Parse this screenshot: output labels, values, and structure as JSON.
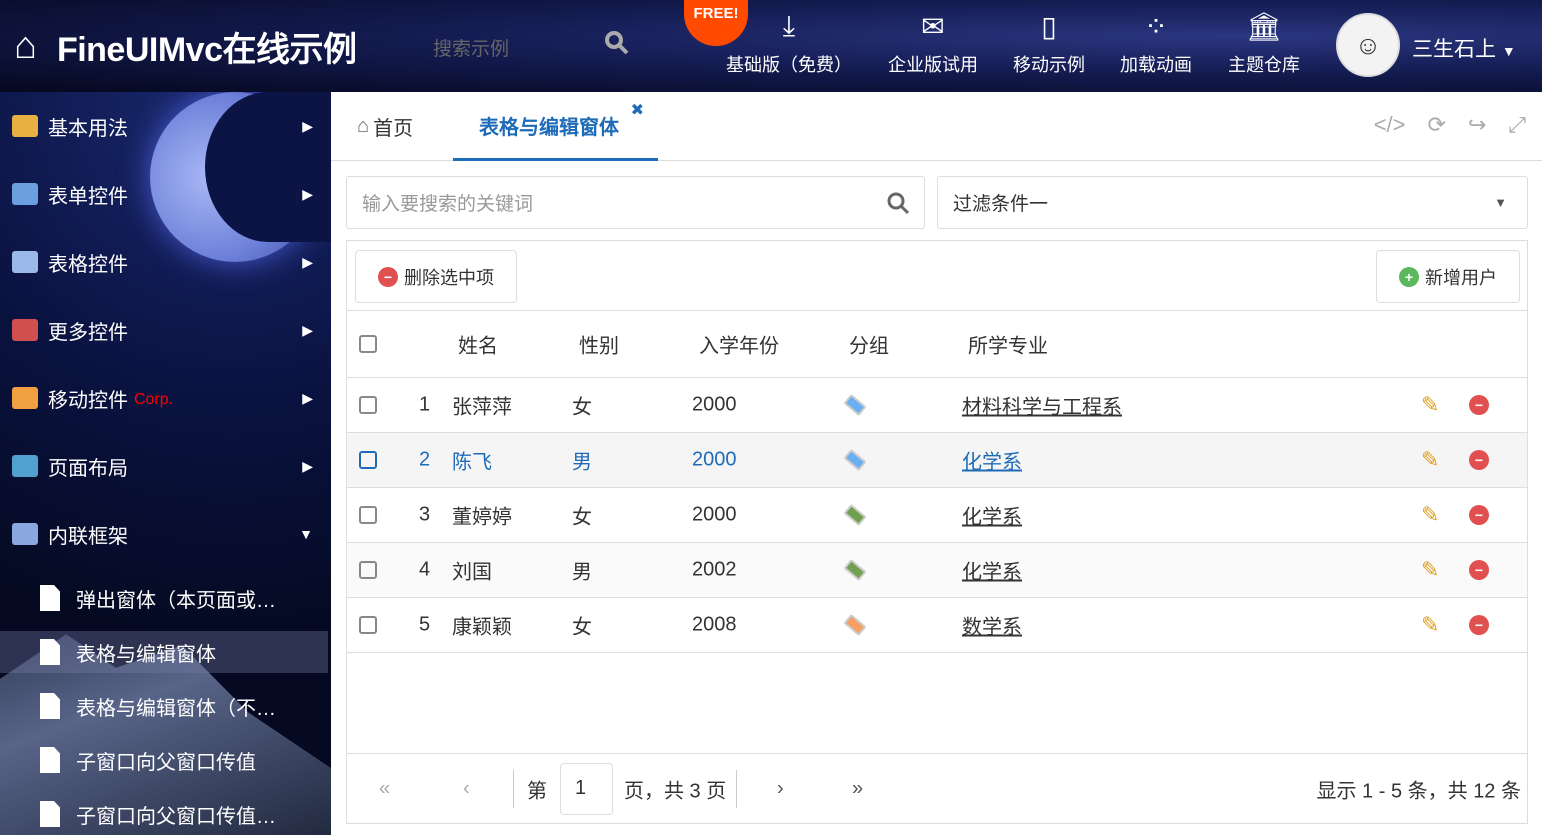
{
  "header": {
    "title": "FineUIMvc在线示例",
    "search_placeholder": "搜索示例",
    "free_badge": "FREE!",
    "nav": [
      {
        "label": "基础版（免费）",
        "icon": "download-icon"
      },
      {
        "label": "企业版试用",
        "icon": "envelope-icon"
      },
      {
        "label": "移动示例",
        "icon": "mobile-icon"
      },
      {
        "label": "加载动画",
        "icon": "spinner-icon"
      },
      {
        "label": "主题仓库",
        "icon": "bank-icon"
      }
    ],
    "user": "三生石上"
  },
  "sidebar": {
    "items": [
      {
        "label": "基本用法",
        "color": "#e8b040"
      },
      {
        "label": "表单控件",
        "color": "#6aa0e0"
      },
      {
        "label": "表格控件",
        "color": "#9ab8e8"
      },
      {
        "label": "更多控件",
        "color": "#d05050"
      },
      {
        "label": "移动控件",
        "badge": "Corp.",
        "color": "#f0a040"
      },
      {
        "label": "页面布局",
        "color": "#50a0d0"
      },
      {
        "label": "内联框架",
        "color": "#8aa8e0"
      }
    ],
    "subitems": [
      {
        "label": "弹出窗体（本页面或…"
      },
      {
        "label": "表格与编辑窗体"
      },
      {
        "label": "表格与编辑窗体（不…"
      },
      {
        "label": "子窗口向父窗口传值"
      },
      {
        "label": "子窗口向父窗口传值…"
      }
    ]
  },
  "tabs": {
    "home": "首页",
    "active": "表格与编辑窗体"
  },
  "search": {
    "placeholder": "输入要搜索的关键词",
    "filter": "过滤条件一"
  },
  "toolbar": {
    "delete": "删除选中项",
    "add": "新增用户"
  },
  "grid": {
    "columns": [
      "姓名",
      "性别",
      "入学年份",
      "分组",
      "所学专业"
    ],
    "rows": [
      {
        "no": "1",
        "name": "张萍萍",
        "gender": "女",
        "year": "2000",
        "tag_color": "#6ab0f0",
        "major": "材料科学与工程系"
      },
      {
        "no": "2",
        "name": "陈飞",
        "gender": "男",
        "year": "2000",
        "tag_color": "#6ab0f0",
        "major": "化学系"
      },
      {
        "no": "3",
        "name": "董婷婷",
        "gender": "女",
        "year": "2000",
        "tag_color": "#70a050",
        "major": "化学系"
      },
      {
        "no": "4",
        "name": "刘国",
        "gender": "男",
        "year": "2002",
        "tag_color": "#70a050",
        "major": "化学系"
      },
      {
        "no": "5",
        "name": "康颖颖",
        "gender": "女",
        "year": "2008",
        "tag_color": "#f5a060",
        "major": "数学系"
      }
    ]
  },
  "pager": {
    "page_prefix": "第",
    "page": "1",
    "page_suffix": "页，共 3 页",
    "summary": "显示 1 - 5 条，共 12 条"
  }
}
